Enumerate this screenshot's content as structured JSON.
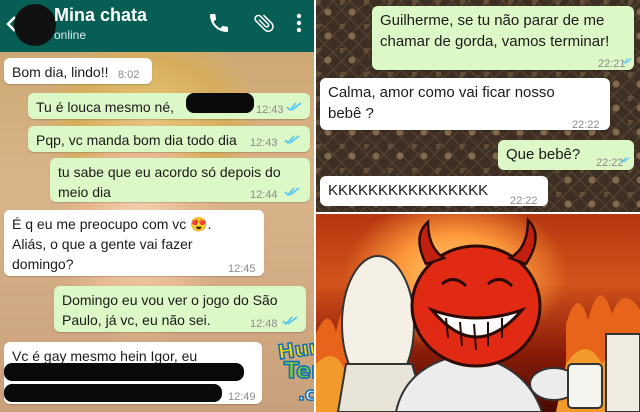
{
  "left_chat": {
    "contact_name": "Mina chata",
    "status": "online",
    "messages": [
      {
        "dir": "in",
        "text": "Bom dia, lindo!!",
        "time": "8:02"
      },
      {
        "dir": "out",
        "text": "Tu é louca mesmo né,",
        "time": "12:43"
      },
      {
        "dir": "out",
        "text": "Pqp, vc manda bom dia todo dia",
        "time": "12:43"
      },
      {
        "dir": "out",
        "line1": "tu sabe que eu acordo só depois do",
        "line2": "meio dia",
        "time": "12:44"
      },
      {
        "dir": "in",
        "line1": "É q eu me preocupo com vc",
        "emoji": "😍",
        "line1_end": ".",
        "line2": "Aliás, o que a gente vai fazer",
        "line3": "domingo?",
        "time": "12:45"
      },
      {
        "dir": "out",
        "line1": "Domingo eu vou ver o jogo do São",
        "line2": "Paulo, já vc, eu não sei.",
        "time": "12:48"
      },
      {
        "dir": "in",
        "text": "Vc é gay mesmo hein Igor, eu",
        "time": "12:49"
      }
    ]
  },
  "right_chat": {
    "messages": [
      {
        "dir": "out",
        "line1": "Guilherme, se tu não parar de me",
        "line2": "chamar de gorda, vamos terminar!",
        "time": "22:21"
      },
      {
        "dir": "in",
        "line1": "Calma, amor como vai ficar nosso",
        "line2": "bebê ?",
        "time": "22:22"
      },
      {
        "dir": "out",
        "text": "Que bebê?",
        "time": "22:22"
      },
      {
        "dir": "in",
        "text": "KKKKKKKKKKKKKKKK",
        "time": "22:22"
      }
    ]
  },
  "watermark": {
    "line1": "Humor",
    "line2": "da",
    "line3": "Terra",
    "line4": ".com"
  },
  "icons": [
    "back-arrow-icon",
    "phone-icon",
    "paperclip-icon",
    "more-vert-icon",
    "double-check-icon"
  ],
  "colors": {
    "header": "#075e54",
    "outgoing": "#dcf8c6",
    "incoming": "#ffffff",
    "read_ticks": "#4fc3f7"
  }
}
